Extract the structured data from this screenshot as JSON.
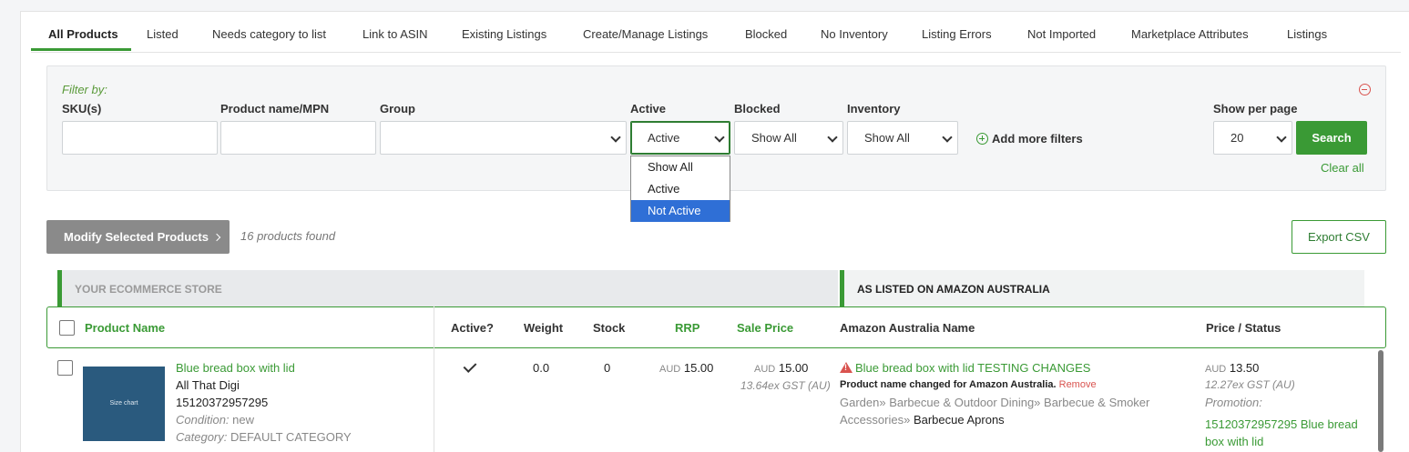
{
  "tabs": [
    "All Products",
    "Listed",
    "Needs category to list",
    "Link to ASIN",
    "Existing Listings",
    "Create/Manage Listings",
    "Blocked",
    "No Inventory",
    "Listing Errors",
    "Not Imported",
    "Marketplace Attributes",
    "Listings"
  ],
  "filter": {
    "title": "Filter by:",
    "sku_label": "SKU(s)",
    "sku_value": "",
    "name_label": "Product name/MPN",
    "name_value": "",
    "group_label": "Group",
    "group_value": "",
    "active_label": "Active",
    "active_value": "Active",
    "active_options": [
      "Show All",
      "Active",
      "Not Active"
    ],
    "active_highlighted": "Not Active",
    "blocked_label": "Blocked",
    "blocked_value": "Show All",
    "inventory_label": "Inventory",
    "inventory_value": "Show All",
    "add_more": "Add more filters",
    "per_page_label": "Show per page",
    "per_page_value": "20",
    "search": "Search",
    "clear_all": "Clear all"
  },
  "actions": {
    "modify": "Modify Selected Products",
    "found": "16 products found",
    "export": "Export CSV"
  },
  "sections": {
    "store": "YOUR ECOMMERCE STORE",
    "amazon": "AS LISTED ON AMAZON AUSTRALIA"
  },
  "columns": {
    "product_name": "Product Name",
    "active": "Active?",
    "weight": "Weight",
    "stock": "Stock",
    "rrp": "RRP",
    "sale_price": "Sale Price",
    "amazon_name": "Amazon Australia Name",
    "price_status": "Price / Status"
  },
  "rows": [
    {
      "thumb_text": "Size chart",
      "name": "Blue bread box with lid",
      "brand": "All That Digi",
      "sku": "15120372957295",
      "condition_label": "Condition:",
      "condition": "new",
      "category_label": "Category:",
      "category": "DEFAULT CATEGORY",
      "weight": "0.0",
      "stock": "0",
      "rrp_currency": "AUD",
      "rrp": "15.00",
      "sale_currency": "AUD",
      "sale": "15.00",
      "sale_ex": "13.64ex GST (AU)",
      "amazon_name": "Blue bread box with lid TESTING CHANGES",
      "change_note": "Product name changed for Amazon Australia.",
      "remove": "Remove",
      "amazon_category_path": "Garden» Barbecue & Outdoor Dining» Barbecue & Smoker",
      "amazon_category_path2": "Accessories»",
      "amazon_category_leaf": "Barbecue Aprons",
      "price_currency": "AUD",
      "price": "13.50",
      "price_ex": "12.27ex GST (AU)",
      "promotion_label": "Promotion:",
      "listing_link_1": "15120372957295 Blue bread",
      "listing_link_2": "box with lid"
    }
  ],
  "colors": {
    "accent": "#3a9a35",
    "highlight": "#2f6fd6",
    "warning": "#d9534f"
  }
}
